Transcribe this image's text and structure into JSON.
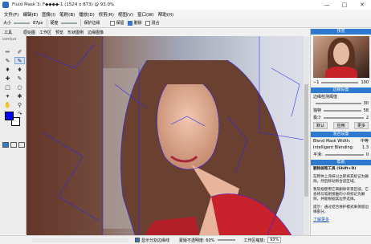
{
  "window": {
    "title": "Fluid Mask 3: F◆◆◆◆-1 (1524 x 873) @ 93.0%",
    "min_label": "—",
    "max_label": "□",
    "close_label": "✕"
  },
  "menu": [
    "文件(F)",
    "编辑(E)",
    "图像(I)",
    "笔刷(B)",
    "播放(D)",
    "修剪(R)",
    "视图(V)",
    "窗口(W)",
    "帮助(H)"
  ],
  "options": {
    "size_label": "大小",
    "size_value": "87px",
    "hardness_label": "硬度",
    "protect_label": "保护边缘",
    "cb1": "保留",
    "cb2": "删除",
    "cb3": "混合"
  },
  "tabs": [
    "工具",
    "原始图",
    "工作区",
    "预览",
    "形状图例",
    "边缘图像"
  ],
  "logo": "vertus",
  "right": {
    "preview_head": "预览",
    "zoom_value": "1",
    "zoom_max": "100",
    "edge_head": "边缘设置",
    "edge_sub": "边缘检测阈值",
    "edge_value": "30",
    "a_label": "独特",
    "a_value": "58",
    "b_label": "极少",
    "b_value": "2",
    "btn_default": "默认",
    "btn_save": "应用",
    "btn_more": "更多",
    "blend_head": "混合设置",
    "blend_width": "Blend Mask Width:",
    "blend_width_val": "中等",
    "int_blend": "Intelligent Blending:",
    "int_blend_val": "1.3",
    "smooth": "平滑:",
    "smooth_val": "0",
    "help_head": "帮助",
    "help_title": "删除画笔工具 (Shift+D)",
    "help_body1": "在物体上涂抹以立即将其标记为删除。然后移动到合适区域。",
    "help_body2": "我常规使用它来删除背景区域，它会将与笔刷接触的小块标记为删除，并能根据其边界选择。",
    "help_body3": "提示：通过结合保护模式来保留边缘部分。",
    "help_link": "了解更多"
  },
  "status": {
    "show_patches": "显示分割边缘线",
    "opacity_label": "蒙版不透明度: 60%",
    "zoom_label": "工作区缩放:",
    "zoom_value": "93%"
  },
  "colors": {
    "accent": "#2e7ad1",
    "foreground": "#0000ff"
  }
}
